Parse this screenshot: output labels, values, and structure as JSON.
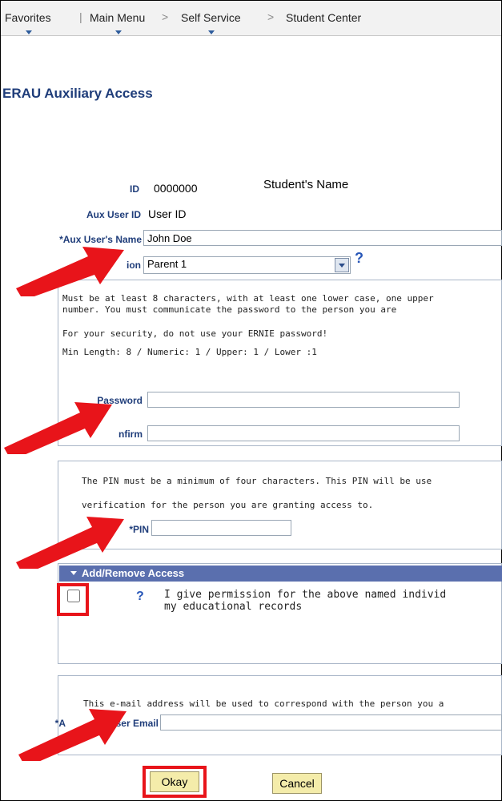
{
  "nav": {
    "favorites": "Favorites",
    "main_menu": "Main Menu",
    "self_service": "Self Service",
    "student_center": "Student Center",
    "separator": ">"
  },
  "page_title": "ERAU Auxiliary Access",
  "fields": {
    "id_label": "ID",
    "id_value": "0000000",
    "student_name": "Student's Name",
    "aux_user_id_label": "Aux User ID",
    "aux_user_id_value": "User ID",
    "aux_user_name_label": "*Aux User's Name",
    "aux_user_name_value": "John Doe",
    "relation_label_visible": "ion",
    "relation_value": "Parent 1"
  },
  "password_section": {
    "line1": "Must be at least 8 characters, with at least one lower case, one upper",
    "line2": "number. You must communicate the password to the person you are",
    "security_note": "For your security, do not use your ERNIE password!",
    "rules": "Min Length: 8 / Numeric: 1 / Upper: 1 / Lower :1",
    "password_label": "Password",
    "confirm_label_visible": "nfirm"
  },
  "pin_section": {
    "line1": "The PIN must be a minimum of four characters. This PIN will be use",
    "line2": "verification for the person you are granting access to.",
    "pin_label": "*PIN"
  },
  "access_section": {
    "header": "Add/Remove Access",
    "permission_line1": "I give permission for the above named individ",
    "permission_line2": "my educational records"
  },
  "email_section": {
    "note": "This e-mail address will be used to correspond with the person you a",
    "email_label_visible": "ux User Email",
    "email_label_prefix": "*A"
  },
  "buttons": {
    "okay": "Okay",
    "cancel": "Cancel"
  },
  "colors": {
    "annotation_red": "#e8141a",
    "label_blue": "#1f3d7a",
    "section_header": "#5a6fae",
    "button_yellow": "#f4ecaa"
  }
}
